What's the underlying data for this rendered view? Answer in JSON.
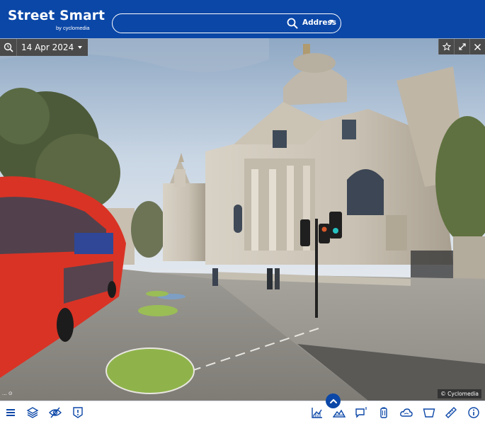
{
  "header": {
    "app_title": "Street Smart",
    "app_subtitle": "by cyclomedia",
    "search": {
      "value": "",
      "placeholder": "",
      "type_label": "Address"
    }
  },
  "viewer": {
    "recording_date": "14 Apr 2024",
    "copyright": "© Cyclomedia",
    "mini_marker": "... ⊙"
  },
  "toolbar_icons": {
    "left": [
      "menu-icon",
      "layers-icon",
      "hide-icon",
      "report-icon"
    ],
    "right": [
      "chart-icon",
      "terrain-icon",
      "comment-icon",
      "battery-icon",
      "cloud-icon",
      "bucket-icon",
      "ruler-icon",
      "info-icon"
    ]
  },
  "colors": {
    "brand": "#0b47a7",
    "toolbar_icon": "#0b47a7",
    "dark_overlay": "#4a4a4a"
  }
}
